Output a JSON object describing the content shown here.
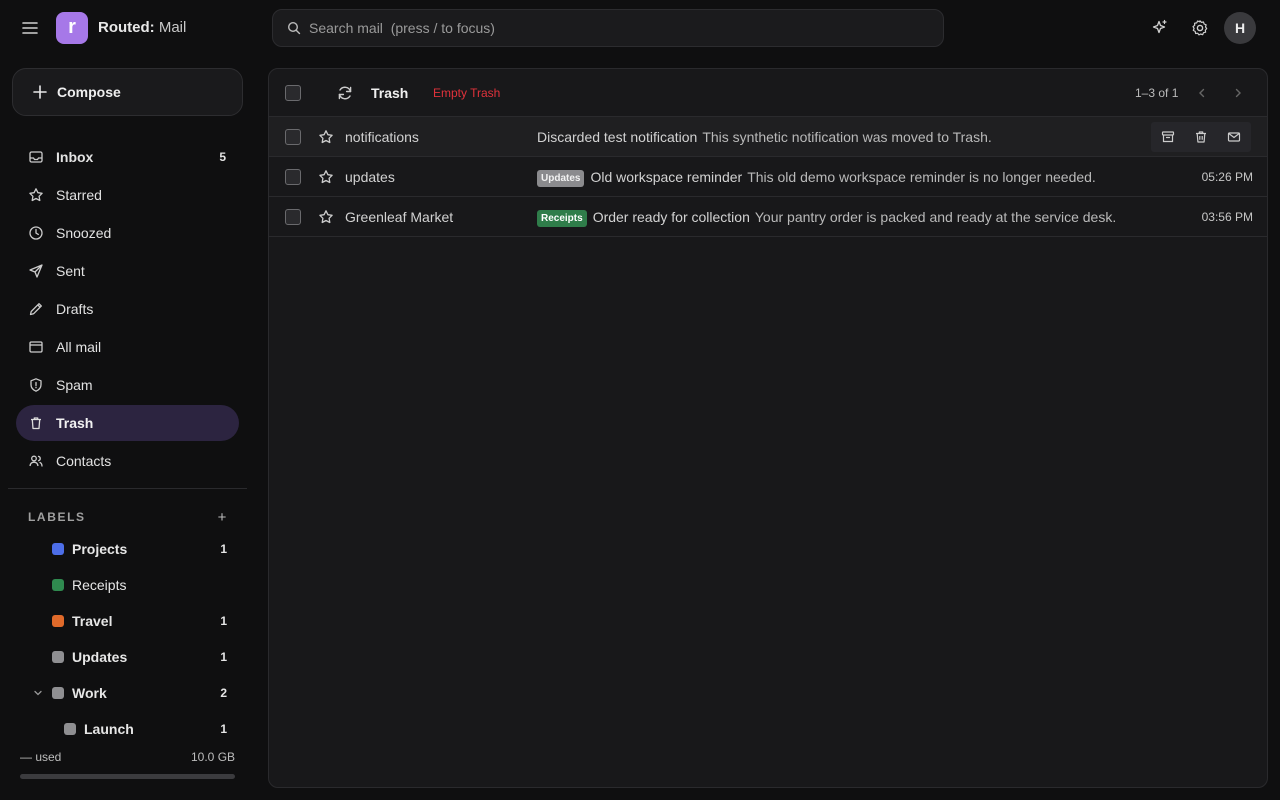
{
  "header": {
    "app_name_bold": "Routed:",
    "app_name_rest": " Mail",
    "logo_letter": "r",
    "search_placeholder": "Search mail  (press / to focus)",
    "avatar_initial": "H"
  },
  "colors": {
    "accent": "#a678e8",
    "active_nav": "#2c2440",
    "danger": "#e0323b"
  },
  "sidebar": {
    "compose_label": "Compose",
    "items": [
      {
        "label": "Inbox",
        "count": "5",
        "icon": "inbox-icon"
      },
      {
        "label": "Starred",
        "icon": "star-icon"
      },
      {
        "label": "Snoozed",
        "icon": "clock-icon"
      },
      {
        "label": "Sent",
        "icon": "send-icon"
      },
      {
        "label": "Drafts",
        "icon": "pencil-icon"
      },
      {
        "label": "All mail",
        "icon": "archive-icon"
      },
      {
        "label": "Spam",
        "icon": "shield-icon"
      },
      {
        "label": "Trash",
        "icon": "trash-icon",
        "active": true
      },
      {
        "label": "Contacts",
        "icon": "users-icon"
      }
    ],
    "labels_heading": "LABELS",
    "labels_add": "+",
    "labels": [
      {
        "name": "Projects",
        "count": "1",
        "color": "#4d6ee8"
      },
      {
        "name": "Receipts",
        "color": "#2f8a4f"
      },
      {
        "name": "Travel",
        "count": "1",
        "color": "#e06a2a"
      },
      {
        "name": "Updates",
        "count": "1",
        "color": "#8f8f92"
      },
      {
        "name": "Work",
        "count": "2",
        "color": "#8f8f92"
      },
      {
        "name": "Launch",
        "count": "1",
        "color": "#8f8f92"
      }
    ],
    "storage_used": "— used",
    "storage_total": "10.0 GB"
  },
  "main": {
    "folder_title": "Trash",
    "empty_trash_label": "Empty Trash",
    "pagination": "1–3 of 1",
    "emails": [
      {
        "sender": "notifications",
        "subject": "Discarded test notification",
        "snippet": "This synthetic notification was moved to Trash.",
        "time": ""
      },
      {
        "sender": "updates",
        "tag": "Updates",
        "subject": "Old workspace reminder",
        "snippet": "This old demo workspace reminder is no longer needed.",
        "time": "05:26 PM"
      },
      {
        "sender": "Greenleaf Market",
        "tag": "Receipts",
        "subject": "Order ready for collection",
        "snippet": "Your pantry order is packed and ready at the service desk.",
        "time": "03:56 PM"
      }
    ]
  }
}
